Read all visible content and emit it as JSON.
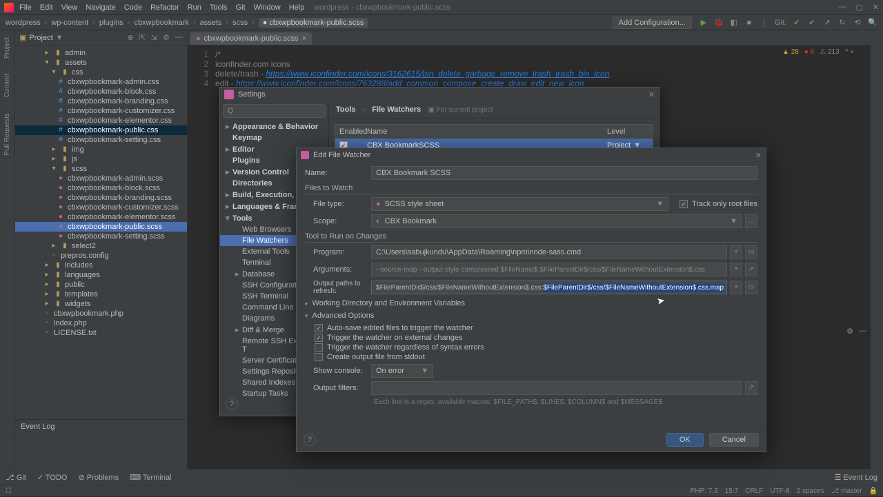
{
  "app": {
    "title": "wordpress - cbxwpbookmark-public.scss"
  },
  "menu": [
    "File",
    "Edit",
    "View",
    "Navigate",
    "Code",
    "Refactor",
    "Run",
    "Tools",
    "Git",
    "Window",
    "Help"
  ],
  "breadcrumb": [
    "wordpress",
    "wp-content",
    "plugins",
    "cbxwpbookmark",
    "assets",
    "scss"
  ],
  "breadcrumb_file": "cbxwpbookmark-public.scss",
  "toolbar": {
    "add_config": "Add Configuration...",
    "git_label": "Git:"
  },
  "project": {
    "label": "Project",
    "tree": [
      {
        "d": 4,
        "t": "dir",
        "n": "admin",
        "exp": "▸"
      },
      {
        "d": 4,
        "t": "dir",
        "n": "assets",
        "exp": "▾"
      },
      {
        "d": 5,
        "t": "dir",
        "n": "css",
        "exp": "▾"
      },
      {
        "d": 6,
        "t": "css",
        "n": "cbxwpbookmark-admin.css"
      },
      {
        "d": 6,
        "t": "css",
        "n": "cbxwpbookmark-block.css"
      },
      {
        "d": 6,
        "t": "css",
        "n": "cbxwpbookmark-branding.css"
      },
      {
        "d": 6,
        "t": "css",
        "n": "cbxwpbookmark-customizer.css"
      },
      {
        "d": 6,
        "t": "css",
        "n": "cbxwpbookmark-elementor.css"
      },
      {
        "d": 6,
        "t": "css",
        "n": "cbxwpbookmark-public.css",
        "sel": true
      },
      {
        "d": 6,
        "t": "css",
        "n": "cbxwpbookmark-setting.css"
      },
      {
        "d": 5,
        "t": "dir",
        "n": "img",
        "exp": "▸"
      },
      {
        "d": 5,
        "t": "dir",
        "n": "js",
        "exp": "▸"
      },
      {
        "d": 5,
        "t": "dir",
        "n": "scss",
        "exp": "▾"
      },
      {
        "d": 6,
        "t": "scss",
        "n": "cbxwpbookmark-admin.scss"
      },
      {
        "d": 6,
        "t": "scss",
        "n": "cbxwpbookmark-block.scss"
      },
      {
        "d": 6,
        "t": "scss",
        "n": "cbxwpbookmark-branding.scss"
      },
      {
        "d": 6,
        "t": "scss",
        "n": "cbxwpbookmark-customizer.scss"
      },
      {
        "d": 6,
        "t": "scss",
        "n": "cbxwpbookmark-elementor.scss"
      },
      {
        "d": 6,
        "t": "scss",
        "n": "cbxwpbookmark-public.scss",
        "hl": true
      },
      {
        "d": 6,
        "t": "scss",
        "n": "cbxwpbookmark-setting.scss"
      },
      {
        "d": 5,
        "t": "dir",
        "n": "select2",
        "exp": "▸"
      },
      {
        "d": 5,
        "t": "file",
        "n": "prepros.config"
      },
      {
        "d": 4,
        "t": "dir",
        "n": "includes",
        "exp": "▸"
      },
      {
        "d": 4,
        "t": "dir",
        "n": "languages",
        "exp": "▸"
      },
      {
        "d": 4,
        "t": "dir",
        "n": "public",
        "exp": "▸"
      },
      {
        "d": 4,
        "t": "dir",
        "n": "templates",
        "exp": "▸"
      },
      {
        "d": 4,
        "t": "dir",
        "n": "widgets",
        "exp": "▸"
      },
      {
        "d": 4,
        "t": "file",
        "n": "cbxwpbookmark.php"
      },
      {
        "d": 4,
        "t": "file",
        "n": "index.php"
      },
      {
        "d": 4,
        "t": "file",
        "n": "LICENSE.txt"
      }
    ]
  },
  "editor_tab": "cbxwpbookmark-public.scss",
  "code": {
    "l1": "/*",
    "l2": "iconfinder.com icons",
    "l3a": "delete/trash - ",
    "l3b": "https://www.iconfinder.com/icons/3162615/bin_delete_garbage_remove_trash_trash_bin_icon",
    "l4a": "edit - ",
    "l4b": "https://www.iconfinder.com/icons/763288/add_common_compose_create_draw_edit_new_icon"
  },
  "inspections": {
    "warn": "28",
    "err": "6",
    "weak": "213",
    "caret": "^"
  },
  "eventlog": {
    "title": "Event Log"
  },
  "bottom_tabs": {
    "git": "Git",
    "todo": "TODO",
    "problems": "Problems",
    "terminal": "Terminal",
    "eventlog": "Event Log"
  },
  "status": {
    "php": "PHP: 7.3",
    "pos": "15:7",
    "crlf": "CRLF",
    "enc": "UTF-8",
    "indent": "2 spaces",
    "branch": "master"
  },
  "settings": {
    "title": "Settings",
    "search_ph": "Q",
    "crumb1": "Tools",
    "crumb2": "File Watchers",
    "proj_hint": "For current project",
    "items": [
      {
        "n": "Appearance & Behavior",
        "b": true,
        "a": "▸"
      },
      {
        "n": "Keymap",
        "b": true
      },
      {
        "n": "Editor",
        "b": true,
        "a": "▸"
      },
      {
        "n": "Plugins",
        "b": true
      },
      {
        "n": "Version Control",
        "b": true,
        "a": "▸"
      },
      {
        "n": "Directories",
        "b": true
      },
      {
        "n": "Build, Execution, Deploy",
        "b": true,
        "a": "▸"
      },
      {
        "n": "Languages & Framework",
        "b": true,
        "a": "▸"
      },
      {
        "n": "Tools",
        "b": true,
        "a": "▾"
      },
      {
        "n": "Web Browsers",
        "i": 1
      },
      {
        "n": "File Watchers",
        "i": 1,
        "sel": true
      },
      {
        "n": "External Tools",
        "i": 1
      },
      {
        "n": "Terminal",
        "i": 1
      },
      {
        "n": "Database",
        "i": 1,
        "a": "▸"
      },
      {
        "n": "SSH Configurations",
        "i": 1
      },
      {
        "n": "SSH Terminal",
        "i": 1
      },
      {
        "n": "Command Line Tool Su",
        "i": 1
      },
      {
        "n": "Diagrams",
        "i": 1
      },
      {
        "n": "Diff & Merge",
        "i": 1,
        "a": "▸"
      },
      {
        "n": "Remote SSH External T",
        "i": 1
      },
      {
        "n": "Server Certificates",
        "i": 1
      },
      {
        "n": "Settings Repository",
        "i": 1
      },
      {
        "n": "Shared Indexes",
        "i": 1
      },
      {
        "n": "Startup Tasks",
        "i": 1
      }
    ],
    "table": {
      "h_enabled": "Enabled",
      "h_name": "Name",
      "h_level": "Level",
      "row_name": "CBX BookmarkSCSS",
      "row_level": "Project"
    }
  },
  "efw": {
    "title": "Edit File Watcher",
    "name_lbl": "Name:",
    "name_val": "CBX Bookmark SCSS",
    "files_sect": "Files to Watch",
    "ftype_lbl": "File type:",
    "ftype_val": "SCSS style sheet",
    "scope_lbl": "Scope:",
    "scope_val": "CBX Bookmark",
    "trackroot": "Track only root files",
    "tool_sect": "Tool to Run on Changes",
    "prog_lbl": "Program:",
    "prog_val": "C:\\Users\\sabujkundu\\AppData\\Roaming\\npm\\node-sass.cmd",
    "args_lbl": "Arguments:",
    "args_val": "--source-map --output-style compressed $FileName$ $FileParentDir$/css/$FileNameWithoutExtension$.css",
    "out_lbl": "Output paths to refresh:",
    "out_v1": "$FileParentDir$/css/$FileNameWithoutExtension$.css:",
    "out_v2": "$FileParentDir$/css/$FileNameWithoutExtension$.css.map",
    "wd_sect": "Working Directory and Environment Variables",
    "adv_sect": "Advanced Options",
    "chk1": "Auto-save edited files to trigger the watcher",
    "chk2": "Trigger the watcher on external changes",
    "chk3": "Trigger the watcher regardless of syntax errors",
    "chk4": "Create output file from stdout",
    "showc_lbl": "Show console:",
    "showc_val": "On error",
    "filters_lbl": "Output filters:",
    "hint": "Each line is a regex, available macros: $FILE_PATH$, $LINE$, $COLUMN$ and $MESSAGE$",
    "ok": "OK",
    "cancel": "Cancel"
  }
}
